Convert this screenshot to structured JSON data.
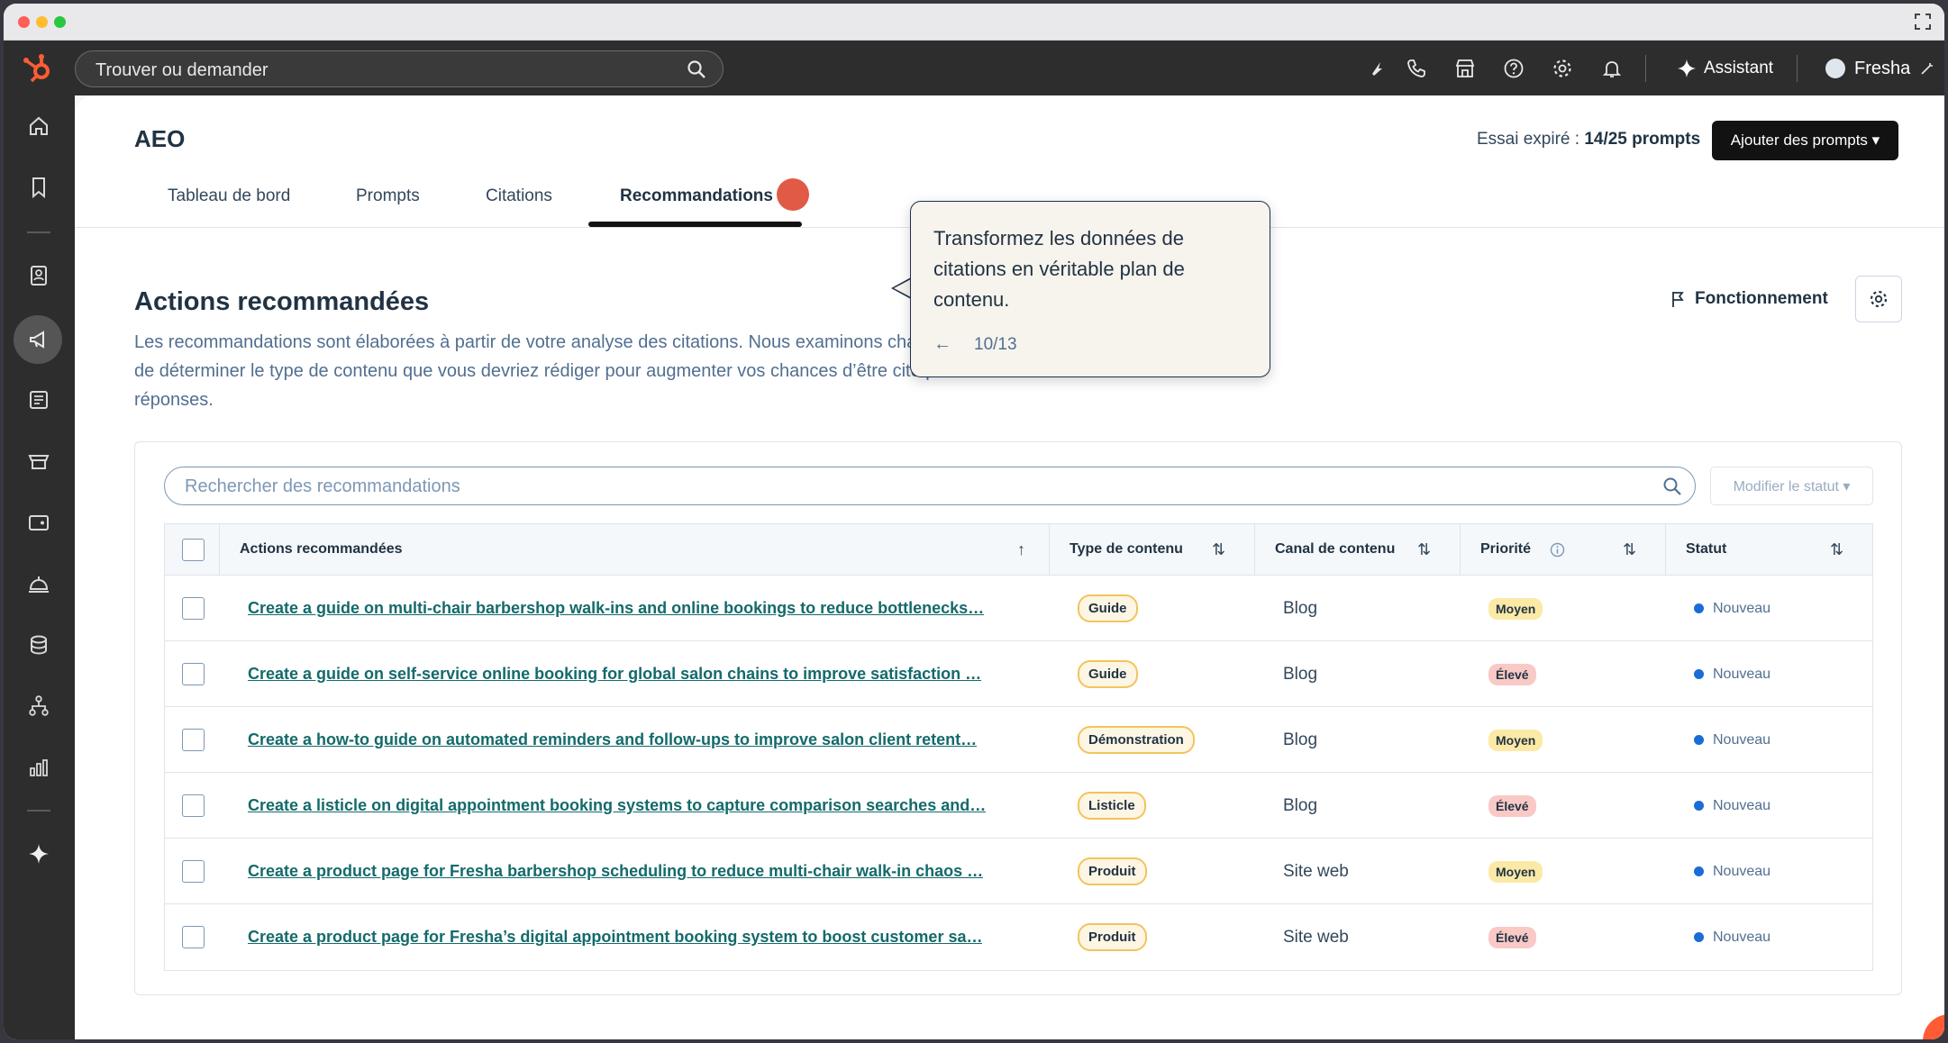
{
  "app": {
    "brand": "HubSpot",
    "brand_color": "#ff5c35"
  },
  "topbar": {
    "search_placeholder": "Trouver ou demander",
    "assistant_label": "Assistant",
    "account_name": "Fresha"
  },
  "page": {
    "title": "AEO",
    "trial_prefix": "Essai expiré : ",
    "trial_count": "14/25 prompts",
    "add_prompts_label": "Ajouter des prompts ▾"
  },
  "tabs": [
    {
      "label": "Tableau de bord",
      "active": false
    },
    {
      "label": "Prompts",
      "active": false
    },
    {
      "label": "Citations",
      "active": false
    },
    {
      "label": "Recommandations",
      "active": true
    }
  ],
  "section": {
    "title": "Actions recommandées",
    "description": "Les recommandations sont élaborées à partir de votre analyse des citations. Nous examinons chaque réponse d’un moteur d’IA afin de déterminer le type de contenu que vous devriez rédiger pour augmenter vos chances d’être cité par ce moteur dans de futures réponses.",
    "howto_label": "Fonctionnement"
  },
  "recommendations": {
    "search_placeholder": "Rechercher des recommandations",
    "status_button": "Modifier le statut ▾",
    "columns": {
      "action": "Actions recommandées",
      "type": "Type de contenu",
      "channel": "Canal de contenu",
      "priority": "Priorité",
      "status": "Statut"
    },
    "rows": [
      {
        "action": "Create a guide on multi-chair barbershop walk-ins and online bookings to reduce bottlenecks…",
        "type": "Guide",
        "channel": "Blog",
        "priority": "Moyen",
        "priority_level": "medium",
        "status": "Nouveau"
      },
      {
        "action": "Create a guide on self-service online booking for global salon chains to improve satisfaction …",
        "type": "Guide",
        "channel": "Blog",
        "priority": "Élevé",
        "priority_level": "high",
        "status": "Nouveau"
      },
      {
        "action": "Create a how-to guide on automated reminders and follow-ups to improve salon client retent…",
        "type": "Démonstration",
        "channel": "Blog",
        "priority": "Moyen",
        "priority_level": "medium",
        "status": "Nouveau"
      },
      {
        "action": "Create a listicle on digital appointment booking systems to capture comparison searches and…",
        "type": "Listicle",
        "channel": "Blog",
        "priority": "Élevé",
        "priority_level": "high",
        "status": "Nouveau"
      },
      {
        "action": "Create a product page for Fresha barbershop scheduling to reduce multi-chair walk-in chaos …",
        "type": "Produit",
        "channel": "Site web",
        "priority": "Moyen",
        "priority_level": "medium",
        "status": "Nouveau"
      },
      {
        "action": "Create a product page for Fresha’s digital appointment booking system to boost customer sa…",
        "type": "Produit",
        "channel": "Site web",
        "priority": "Élevé",
        "priority_level": "high",
        "status": "Nouveau"
      }
    ]
  },
  "tour": {
    "message": "Transformez les données de citations en véritable plan de contenu.",
    "back_icon": "←",
    "step": "10/13"
  }
}
